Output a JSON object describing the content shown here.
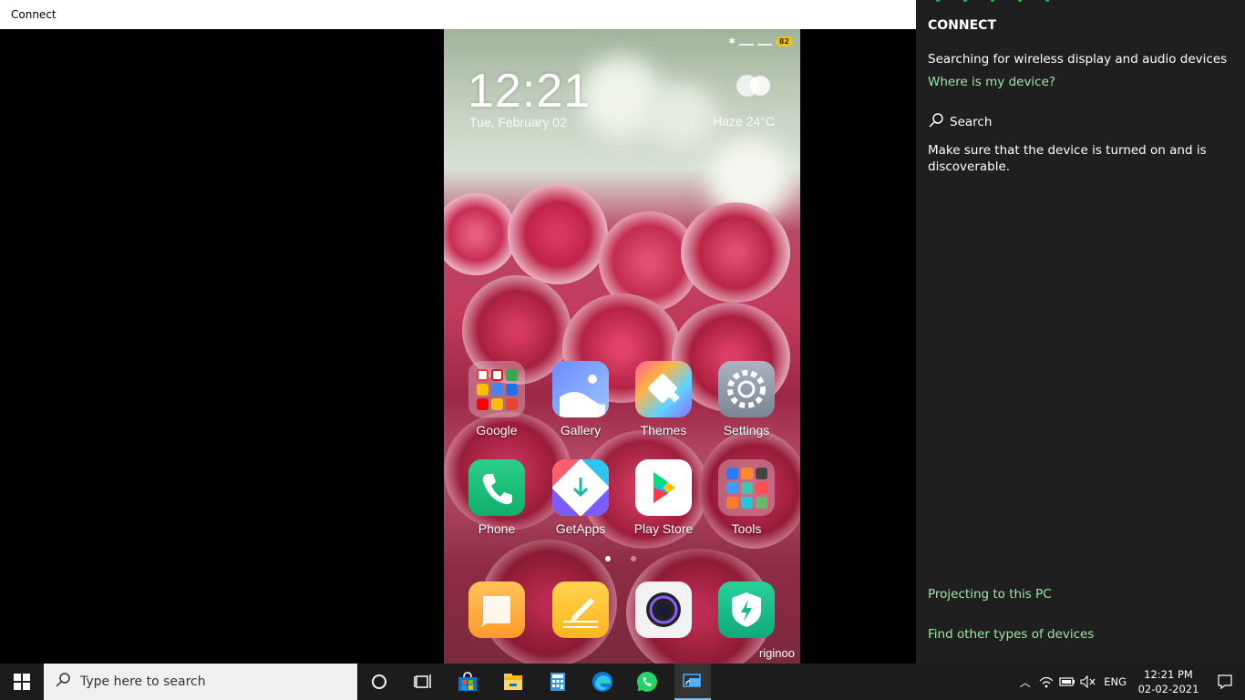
{
  "window": {
    "title": "Connect"
  },
  "phone": {
    "time": "12:21",
    "date": "Tue, February 02",
    "weather": "Haze  24°C",
    "battery": "82",
    "watermark": "riginoo",
    "apps": [
      {
        "label": "Google",
        "icon": "google-folder-icon"
      },
      {
        "label": "Gallery",
        "icon": "gallery-icon"
      },
      {
        "label": "Themes",
        "icon": "themes-icon"
      },
      {
        "label": "Settings",
        "icon": "settings-gear-icon"
      },
      {
        "label": "Phone",
        "icon": "phone-icon"
      },
      {
        "label": "GetApps",
        "icon": "getapps-icon"
      },
      {
        "label": "Play Store",
        "icon": "play-store-icon"
      },
      {
        "label": "Tools",
        "icon": "tools-folder-icon"
      }
    ],
    "dock": [
      {
        "icon": "messaging-icon"
      },
      {
        "icon": "notes-icon"
      },
      {
        "icon": "camera-icon"
      },
      {
        "icon": "security-icon"
      }
    ]
  },
  "panel": {
    "title": "CONNECT",
    "searching": "Searching for wireless display and audio devices",
    "where_link": "Where is my device?",
    "search_label": "Search",
    "make_sure": "Make sure that the device is turned on and is discoverable.",
    "projecting_link": "Projecting to this PC",
    "find_link": "Find other types of devices",
    "accent": "#9ee6a4"
  },
  "taskbar": {
    "search_placeholder": "Type here to search",
    "language": "ENG",
    "time": "12:21 PM",
    "date": "02-02-2021",
    "apps": [
      "cortana-icon",
      "task-view-icon",
      "store-icon",
      "file-explorer-icon",
      "calculator-icon",
      "edge-icon",
      "whatsapp-icon",
      "connect-app-icon"
    ]
  }
}
